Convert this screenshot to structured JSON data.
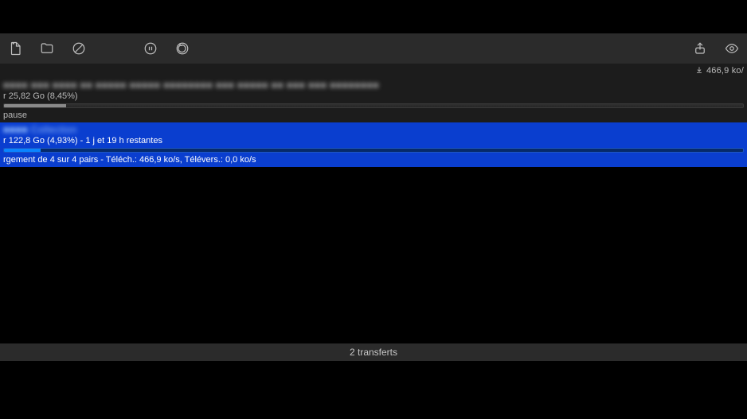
{
  "speed": {
    "download": "466,9 ko/"
  },
  "rows": [
    {
      "selected": false,
      "title_blurred": "■■■■ ■■■ ■■■■ ■■ ■■■■■ ■■■■■ ■■■■■■■■ ■■■ ■■■■■ ■■ ■■■ ■■■ ■■■■■■■■",
      "sub": "r 25,82 Go (8,45%)",
      "progress_percent": 8.45,
      "progress_color": "gray",
      "status": "pause"
    },
    {
      "selected": true,
      "title_blurred": "■■■■ Collection",
      "sub": "r 122,8 Go (4,93%) - 1 j et 19 h restantes",
      "progress_percent": 4.93,
      "progress_color": "blue",
      "status": "rgement de 4 sur 4 pairs - Téléch.: 466,9 ko/s, Télévers.: 0,0 ko/s"
    }
  ],
  "statusbar": {
    "text": "2 transferts"
  }
}
